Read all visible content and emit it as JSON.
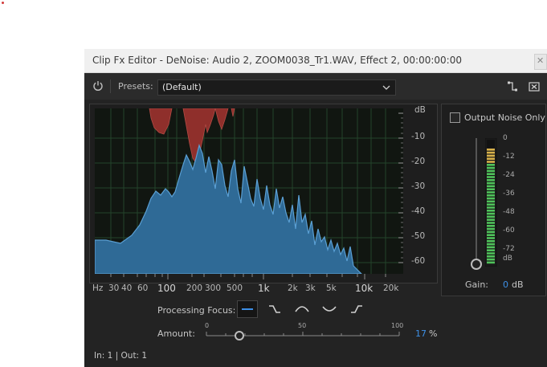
{
  "window": {
    "title": "Clip Fx Editor - DeNoise: Audio 2, ZOOM0038_Tr1.WAV, Effect 2, 00:00:00:00"
  },
  "toolbar": {
    "presets_label": "Presets:",
    "preset_value": "(Default)",
    "icons": [
      "power-icon",
      "chevron-down-icon",
      "route-icon",
      "clip-x-icon"
    ]
  },
  "spectrum": {
    "db_scale": [
      "dB",
      "-10",
      "-20",
      "-30",
      "-40",
      "-50",
      "-60"
    ],
    "hz_scale": [
      "Hz",
      "30",
      "40",
      "60",
      "100",
      "200",
      "300",
      "500",
      "1k",
      "2k",
      "3k",
      "5k",
      "10k",
      "20k"
    ],
    "colors": {
      "signal": "#3f7fb3",
      "noise": "#9a3330",
      "grid": "#2a5a2a"
    }
  },
  "output": {
    "checkbox_label": "Output Noise Only",
    "checked": false,
    "meter_scale": [
      "0",
      "-12",
      "-24",
      "-36",
      "-48",
      "-60",
      "-72",
      "dB"
    ],
    "gain_label": "Gain:",
    "gain_value": "0",
    "gain_unit": "dB"
  },
  "focus": {
    "label": "Processing Focus:",
    "options": [
      "focus-flat-icon",
      "focus-low-icon",
      "focus-mid-icon",
      "focus-notch-icon",
      "focus-high-icon"
    ],
    "selected": 0
  },
  "amount": {
    "label": "Amount:",
    "scale": [
      "0",
      "50",
      "100"
    ],
    "value": "17",
    "unit": "%",
    "fraction": 0.17
  },
  "status": {
    "io": "In: 1 | Out: 1"
  }
}
